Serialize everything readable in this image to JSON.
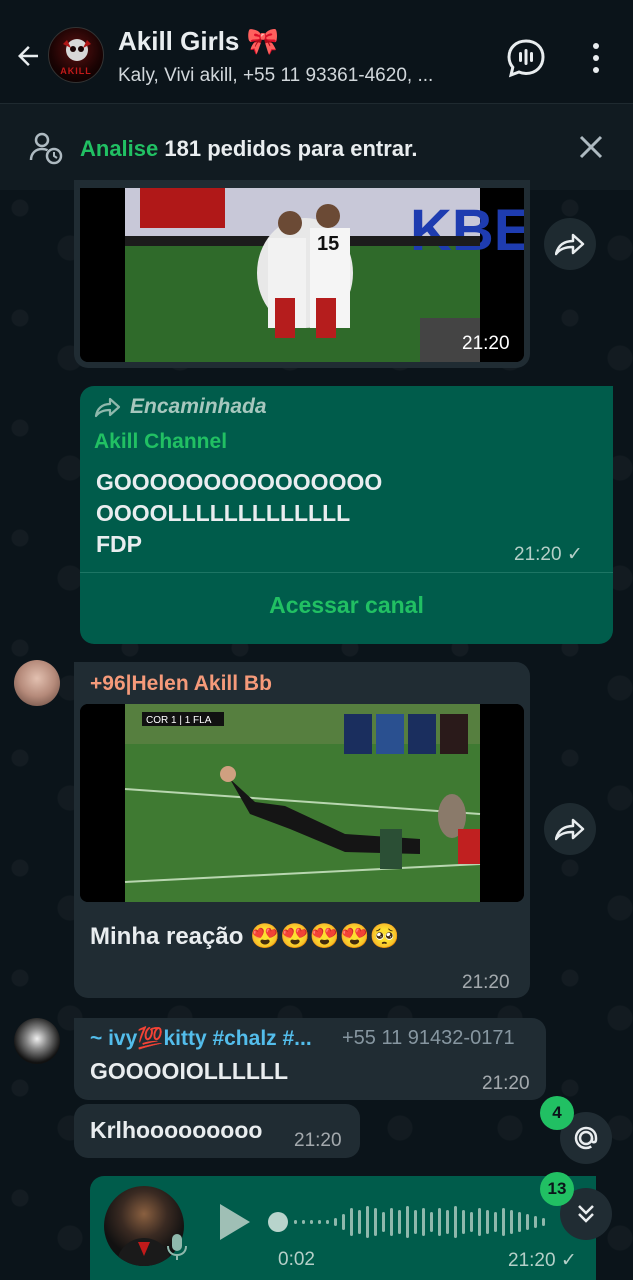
{
  "header": {
    "title": "Akill Girls 🎀",
    "members": "Kaly, Vivi   akill, +55 11 93361-4620, ...",
    "avatar_text": "AKILL"
  },
  "banner": {
    "accent": "Analise",
    "text": " 181 pedidos para entrar."
  },
  "messages": {
    "video1": {
      "time": "21:20"
    },
    "forward": {
      "label": "Encaminhada",
      "channel": "Akill Channel",
      "line1": "GOOOOOOOOOOOOOOO",
      "line2": "OOOOLLLLLLLLLLLLL",
      "line3": "FDP",
      "time": "21:20 ✓",
      "action": "Acessar canal"
    },
    "helen": {
      "sender": "+96|Helen Akill Bb",
      "scoreboard": "COR 1 | 1 FLA",
      "text": "Minha reação 😍😍😍😍🥺",
      "time": "21:20"
    },
    "ivy": {
      "sender": "~ ivy💯kitty #chalz #...",
      "phone": "+55 11 91432-0171",
      "text": "GOOOOIOLLLLLL",
      "time": "21:20"
    },
    "krl": {
      "text": "Krlhooooooooo",
      "time": "21:20"
    },
    "voice": {
      "duration": "0:02",
      "time": "21:20 ✓"
    }
  },
  "badges": {
    "mentions": "4",
    "unread": "13"
  },
  "colors": {
    "accent": "#21c063",
    "outgoing": "#005c4b",
    "incoming": "#202c33",
    "helen_name": "#f59a7a",
    "ivy_name": "#53bdeb"
  }
}
